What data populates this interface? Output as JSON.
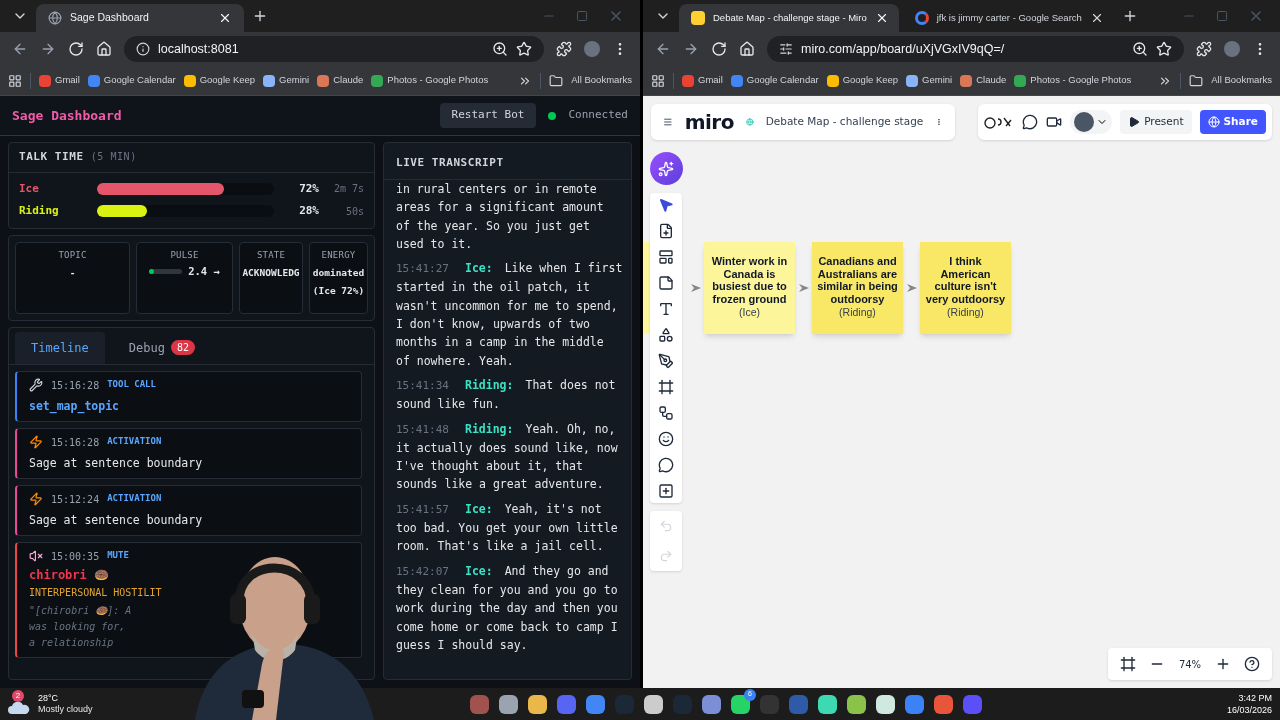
{
  "left_window": {
    "tabs": [
      {
        "title": "Sage Dashboard",
        "selected": true
      }
    ],
    "address": "localhost:8081",
    "bookmarks": [
      "Gmail",
      "Google Calendar",
      "Google Keep",
      "Gemini",
      "Claude",
      "Photos - Google Photos"
    ],
    "all_bookmarks": "All Bookmarks"
  },
  "right_window": {
    "tabs": [
      {
        "title": "Debate Map - challenge stage - Miro",
        "selected": true
      },
      {
        "title": "jfk is jimmy carter - Google Search",
        "selected": false
      }
    ],
    "address": "miro.com/app/board/uXjVGxIV9qQ=/",
    "bookmarks": [
      "Gmail",
      "Google Calendar",
      "Google Keep",
      "Gemini",
      "Claude",
      "Photos - Google Photos"
    ],
    "all_bookmarks": "All Bookmarks"
  },
  "dashboard": {
    "title": "Sage Dashboard",
    "restart_button": "Restart Bot",
    "status": {
      "text": "Connected",
      "connected": true
    },
    "talk_time": {
      "title": "TALK TIME",
      "subtitle": "(5 MIN)",
      "speakers": [
        {
          "name": "Ice",
          "color": "#e5566b",
          "level": 0.72,
          "percent": "72%",
          "duration": "2m 7s"
        },
        {
          "name": "Riding",
          "color": "#d9f20f",
          "level": 0.28,
          "percent": "28%",
          "duration": "50s"
        }
      ]
    },
    "stats": [
      {
        "kind": "text",
        "label": "TOPIC",
        "value": "-"
      },
      {
        "kind": "meter",
        "label": "PULSE",
        "value": "2.4 →",
        "level": 0.05
      },
      {
        "kind": "text",
        "label": "STATE",
        "value": "ACKNOWLEDG"
      },
      {
        "kind": "text",
        "label": "ENERGY",
        "value": "dominated (Ice 72%)"
      }
    ],
    "tabs": [
      {
        "label": "Timeline",
        "selected": true
      },
      {
        "label": "Debug",
        "selected": false,
        "badge": "82"
      }
    ],
    "timeline": [
      {
        "kind": "tool_call",
        "time": "15:16:28",
        "type": "TOOL CALL",
        "text": "set_map_topic"
      },
      {
        "kind": "activation",
        "time": "15:16:28",
        "type": "ACTIVATION",
        "text": "Sage at sentence boundary"
      },
      {
        "kind": "activation",
        "time": "15:12:24",
        "type": "ACTIVATION",
        "text": "Sage at sentence boundary"
      },
      {
        "kind": "mute",
        "time": "15:00:35",
        "type": "MUTE",
        "user": "chirobri 🍩",
        "category": "INTERPERSONAL HOSTILIT",
        "quote": [
          "\"[chirobri 🍩]: A",
          "was looking for,",
          "a relationship"
        ]
      }
    ],
    "transcript": {
      "title": "LIVE TRANSCRIPT",
      "lines": [
        {
          "text": "in rural centers or in remote areas for a significant amount of the year. So you just get used to it."
        },
        {
          "time": "15:41:27",
          "speaker": "Ice:",
          "text": "Like when I first started in the oil patch, it wasn't uncommon for me to spend, I don't know, upwards of two months in a camp in the middle of nowhere. Yeah."
        },
        {
          "time": "15:41:34",
          "speaker": "Riding:",
          "text": "That does not sound like fun."
        },
        {
          "time": "15:41:48",
          "speaker": "Riding:",
          "text": "Yeah. Oh, no, it actually does sound like, now I've thought about it, that sounds like a great adventure."
        },
        {
          "time": "15:41:57",
          "speaker": "Ice:",
          "text": "Yeah, it's not too bad. You get your own little room. That's like a jail cell."
        },
        {
          "time": "15:42:07",
          "speaker": "Ice:",
          "text": "And they go and they clean for you and you go to work during the day and then you come home or come back to camp I guess I should say."
        }
      ]
    }
  },
  "miro": {
    "logo": "miro",
    "board_title": "Debate Map - challenge stage",
    "present_button": "Present",
    "share_button": "Share",
    "notes": [
      {
        "text": "Winter work in Canada is busiest due to frozen ground",
        "author": "(Ice)",
        "color": "#fdf59a"
      },
      {
        "text": "Canadians and Australians are similar in being outdoorsy",
        "author": "(Riding)",
        "color": "#f9e866"
      },
      {
        "text": "I think American culture isn't very outdoorsy",
        "author": "(Riding)",
        "color": "#f9e866"
      }
    ],
    "zoom": "74%"
  },
  "taskbar": {
    "weather": {
      "badge": "2",
      "temp": "28°C",
      "desc": "Mostly cloudy"
    },
    "whatsapp_badge": "6",
    "time": "3:42 PM",
    "date": "16/03/2026"
  }
}
